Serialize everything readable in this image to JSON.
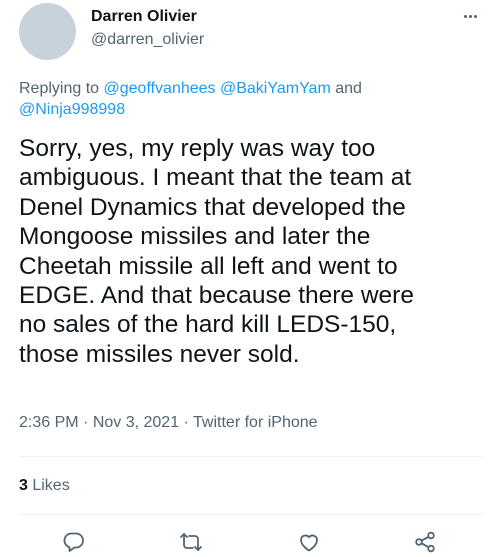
{
  "author": {
    "name": "Darren Olivier",
    "handle": "@darren_olivier"
  },
  "reply": {
    "prefix": "Replying to ",
    "mention_1": "@geoffvanhees",
    "mention_2": "@BakiYamYam",
    "joiner": " and",
    "mention_3": "@Ninja998998"
  },
  "tweet": {
    "text": "Sorry, yes, my reply was way too\nambiguous. I meant that the team at\nDenel Dynamics that developed the\nMongoose missiles and later the\nCheetah missile all left and went to\nEDGE. And that because there were\nno sales of the hard kill LEDS-150,\nthose missiles never sold."
  },
  "meta": {
    "time": "2:36 PM",
    "sep_1": " · ",
    "date": "Nov 3, 2021",
    "sep_2": " · ",
    "source": "Twitter for iPhone"
  },
  "stats": {
    "likes_count": "3",
    "likes_label": " Likes"
  },
  "icons": {
    "more": "more-horizontal-icon",
    "reply": "reply-icon",
    "retweet": "retweet-icon",
    "like": "heart-icon",
    "share": "share-icon"
  },
  "colors": {
    "text": "#0f1419",
    "secondary": "#536471",
    "link": "#1d9bf0",
    "divider": "#eff3f4"
  }
}
